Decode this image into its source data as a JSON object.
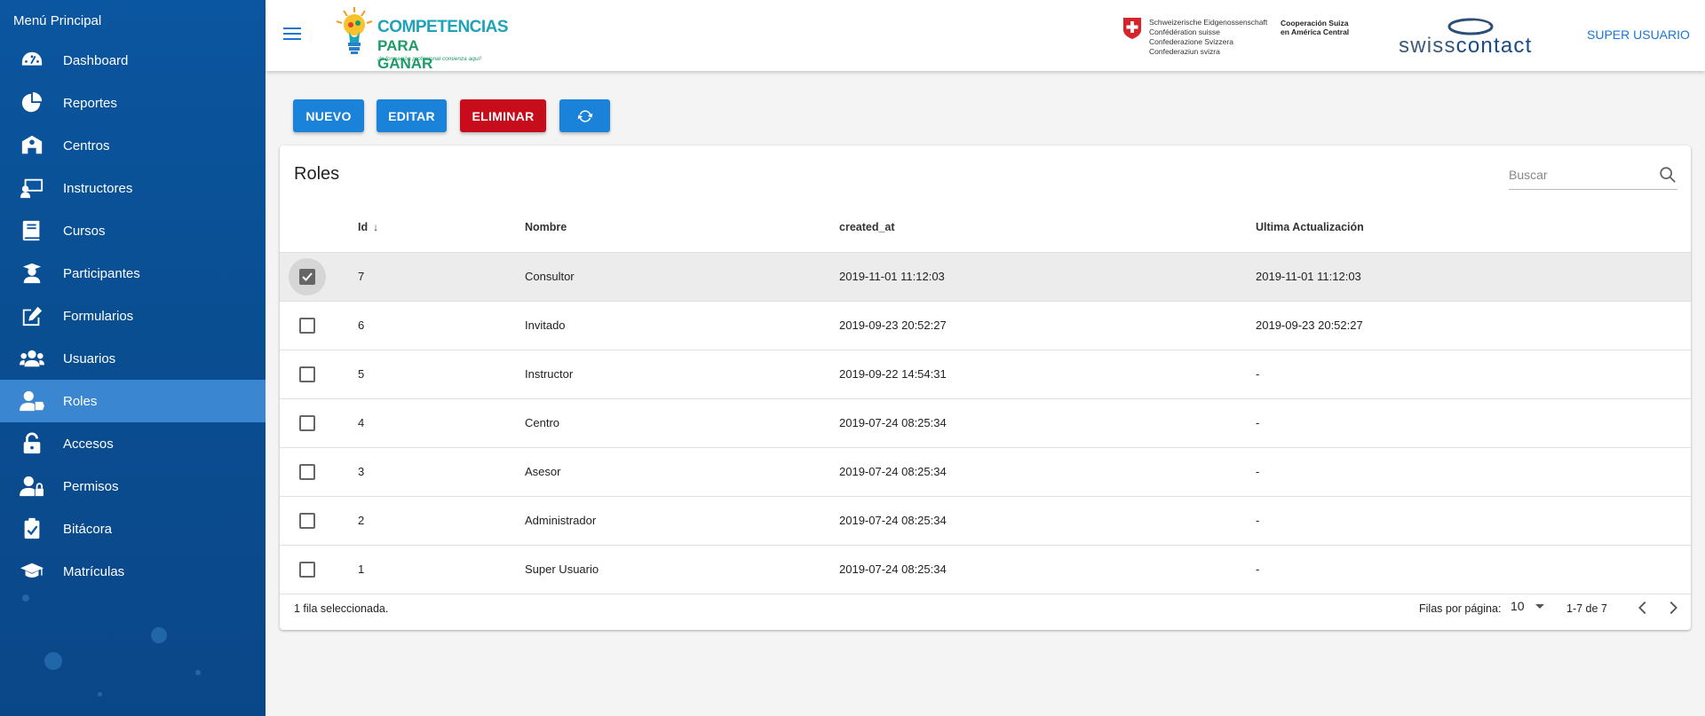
{
  "sidebar": {
    "title": "Menú Principal",
    "items": [
      {
        "label": "Dashboard",
        "icon": "speedometer-icon"
      },
      {
        "label": "Reportes",
        "icon": "pie-chart-icon"
      },
      {
        "label": "Centros",
        "icon": "school-building-icon"
      },
      {
        "label": "Instructores",
        "icon": "teacher-icon"
      },
      {
        "label": "Cursos",
        "icon": "book-icon"
      },
      {
        "label": "Participantes",
        "icon": "student-icon"
      },
      {
        "label": "Formularios",
        "icon": "edit-form-icon"
      },
      {
        "label": "Usuarios",
        "icon": "users-icon"
      },
      {
        "label": "Roles",
        "icon": "user-tag-icon"
      },
      {
        "label": "Accesos",
        "icon": "unlock-icon"
      },
      {
        "label": "Permisos",
        "icon": "user-lock-icon"
      },
      {
        "label": "Bitácora",
        "icon": "clipboard-check-icon"
      },
      {
        "label": "Matrículas",
        "icon": "graduation-cap-icon"
      }
    ],
    "active_index": 8
  },
  "header": {
    "logo_title": "COMPETENCIAS",
    "logo_subtitle": "PARA GANAR",
    "logo_tagline": "¡la formación profesional comienza aquí!",
    "confederation_lines": [
      "Schweizerische Eidgenossenschaft",
      "Confédération suisse",
      "Confederazione Svizzera",
      "Confederaziun svizra"
    ],
    "cooperation_lines": [
      "Cooperación Suiza",
      "en América Central"
    ],
    "brand_part1": "swiss",
    "brand_part2": "contact",
    "user_label": "SUPER USUARIO"
  },
  "toolbar": {
    "new_label": "NUEVO",
    "edit_label": "EDITAR",
    "delete_label": "ELIMINAR",
    "refresh_icon": "refresh-icon"
  },
  "table": {
    "title": "Roles",
    "search_placeholder": "Buscar",
    "columns": [
      "Id",
      "Nombre",
      "created_at",
      "Ultima Actualización"
    ],
    "sort_column": "Id",
    "rows": [
      {
        "id": "7",
        "nombre": "Consultor",
        "created_at": "2019-11-01 11:12:03",
        "updated": "2019-11-01 11:12:03",
        "selected": true
      },
      {
        "id": "6",
        "nombre": "Invitado",
        "created_at": "2019-09-23 20:52:27",
        "updated": "2019-09-23 20:52:27",
        "selected": false
      },
      {
        "id": "5",
        "nombre": "Instructor",
        "created_at": "2019-09-22 14:54:31",
        "updated": "-",
        "selected": false
      },
      {
        "id": "4",
        "nombre": "Centro",
        "created_at": "2019-07-24 08:25:34",
        "updated": "-",
        "selected": false
      },
      {
        "id": "3",
        "nombre": "Asesor",
        "created_at": "2019-07-24 08:25:34",
        "updated": "-",
        "selected": false
      },
      {
        "id": "2",
        "nombre": "Administrador",
        "created_at": "2019-07-24 08:25:34",
        "updated": "-",
        "selected": false
      },
      {
        "id": "1",
        "nombre": "Super Usuario",
        "created_at": "2019-07-24 08:25:34",
        "updated": "-",
        "selected": false
      }
    ],
    "selection_text": "1 fila seleccionada.",
    "rows_per_page_label": "Filas por página:",
    "rows_per_page_value": "10",
    "range_text": "1-7 de 7"
  },
  "colors": {
    "sidebar": "#0b56a0",
    "sidebar_active": "#3a86d0",
    "primary": "#1a82d9",
    "danger": "#c70c1c"
  }
}
